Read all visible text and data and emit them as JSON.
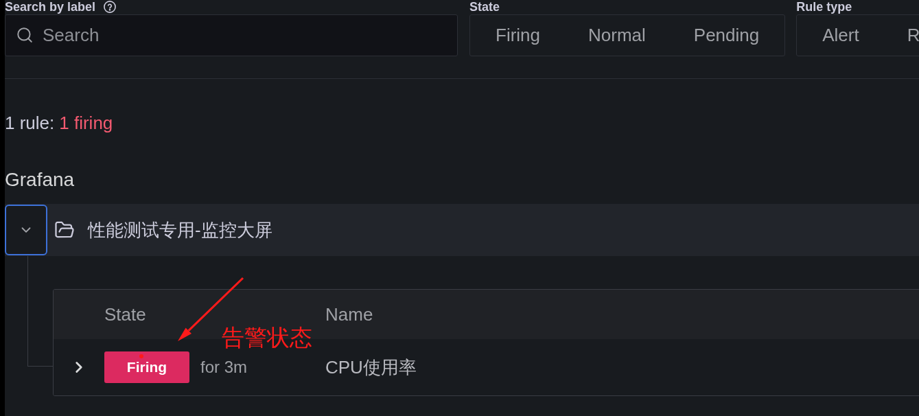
{
  "filters": {
    "search": {
      "label": "Search by label",
      "placeholder": "Search"
    },
    "state": {
      "label": "State",
      "options": [
        {
          "label": "Firing",
          "selected": false
        },
        {
          "label": "Normal",
          "selected": false
        },
        {
          "label": "Pending",
          "selected": false
        }
      ]
    },
    "rule_type": {
      "label": "Rule type",
      "options": [
        {
          "label": "Alert",
          "selected": false
        },
        {
          "label": "R",
          "selected": false
        }
      ]
    }
  },
  "summary": {
    "total": "1 rule:",
    "firing": "1 firing"
  },
  "sections": [
    {
      "title": "Grafana",
      "folders": [
        {
          "name": "性能测试专用-监控大屏",
          "expanded": true,
          "columns": [
            "State",
            "Name"
          ],
          "rules": [
            {
              "state": "Firing",
              "kind": "firing",
              "duration": "for 3m",
              "name": "CPU使用率",
              "expanded": false
            }
          ]
        }
      ]
    }
  ],
  "annotation": {
    "text": "告警状态"
  }
}
